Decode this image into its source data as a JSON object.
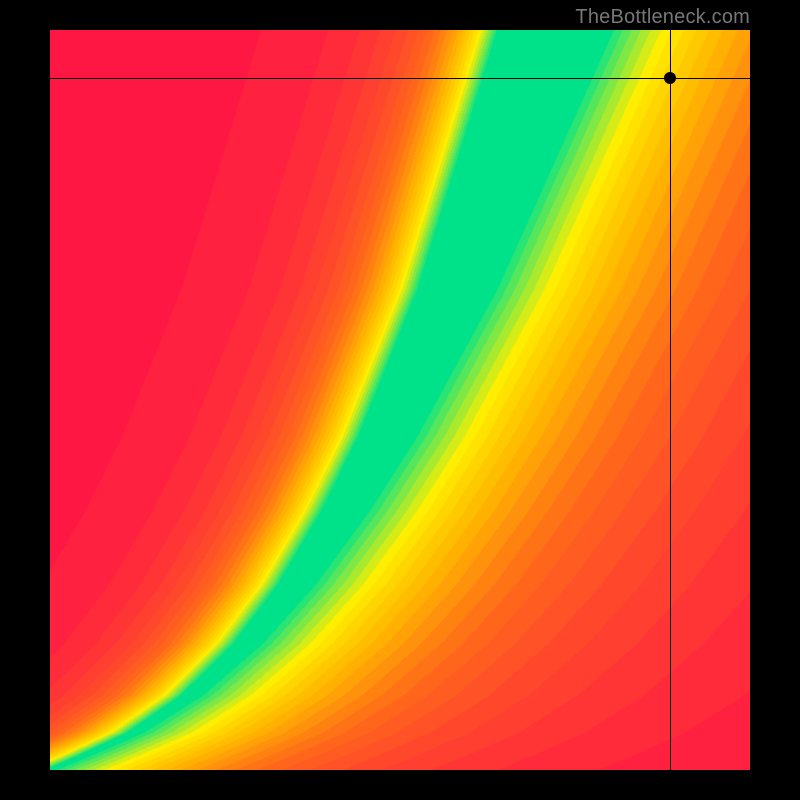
{
  "attribution": "TheBottleneck.com",
  "chart_data": {
    "type": "heatmap",
    "title": "",
    "xlabel": "",
    "ylabel": "",
    "xlim": [
      0,
      1
    ],
    "ylim": [
      0,
      1
    ],
    "legend": false,
    "grid": false,
    "colorscale": [
      {
        "stop": 0.0,
        "color": "#ff1744"
      },
      {
        "stop": 0.35,
        "color": "#ff6a1a"
      },
      {
        "stop": 0.55,
        "color": "#ffb300"
      },
      {
        "stop": 0.75,
        "color": "#ffee00"
      },
      {
        "stop": 1.0,
        "color": "#00e28a"
      }
    ],
    "ridge": [
      {
        "x": 0.0,
        "y": 0.0
      },
      {
        "x": 0.05,
        "y": 0.02
      },
      {
        "x": 0.12,
        "y": 0.05
      },
      {
        "x": 0.2,
        "y": 0.1
      },
      {
        "x": 0.28,
        "y": 0.17
      },
      {
        "x": 0.35,
        "y": 0.25
      },
      {
        "x": 0.42,
        "y": 0.35
      },
      {
        "x": 0.48,
        "y": 0.45
      },
      {
        "x": 0.53,
        "y": 0.55
      },
      {
        "x": 0.58,
        "y": 0.65
      },
      {
        "x": 0.62,
        "y": 0.75
      },
      {
        "x": 0.66,
        "y": 0.85
      },
      {
        "x": 0.7,
        "y": 0.95
      },
      {
        "x": 0.72,
        "y": 1.0
      }
    ],
    "ridge_width": {
      "start": 0.005,
      "end": 0.08
    },
    "crosshair": {
      "x": 0.885,
      "y": 0.935
    },
    "marker": {
      "x": 0.885,
      "y": 0.935
    }
  }
}
